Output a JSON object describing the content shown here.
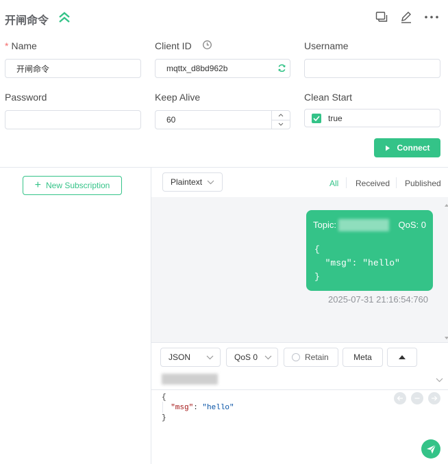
{
  "header": {
    "title": "开闸命令",
    "icons": [
      "collapse-up-icon",
      "new-window-icon",
      "edit-icon",
      "more-icon"
    ]
  },
  "form": {
    "name_label": "Name",
    "name_required_mark": "*",
    "name_value": "开闸命令",
    "client_id_label": "Client ID",
    "client_id_value": "mqttx_d8bd962b",
    "username_label": "Username",
    "username_value": "",
    "password_label": "Password",
    "password_value": "",
    "keep_alive_label": "Keep Alive",
    "keep_alive_value": "60",
    "clean_start_label": "Clean Start",
    "clean_start_value": "true",
    "connect_label": "Connect"
  },
  "sidebar": {
    "new_subscription_label": "New Subscription"
  },
  "messages": {
    "payload_type": "Plaintext",
    "filters": [
      "All",
      "Received",
      "Published"
    ],
    "active_filter": "All",
    "items": [
      {
        "topic_prefix": "Topic:",
        "qos": "QoS: 0",
        "payload": "{\n  \"msg\": \"hello\"\n}",
        "time": "2025-07-31 21:16:54:760"
      }
    ]
  },
  "composer": {
    "format": "JSON",
    "qos": "QoS 0",
    "retain_label": "Retain",
    "meta_label": "Meta",
    "payload_line1": "{",
    "payload_key": "\"msg\"",
    "payload_colon": ": ",
    "payload_value": "\"hello\"",
    "payload_line3": "}"
  },
  "colors": {
    "accent": "#34c388",
    "border": "#dcdfe6",
    "list_bg": "#f4f5f7"
  }
}
